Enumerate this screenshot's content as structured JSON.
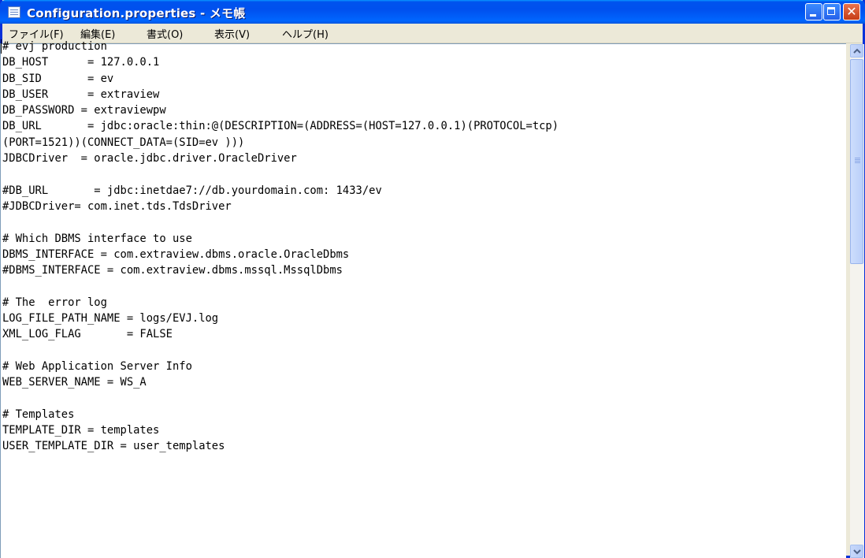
{
  "window": {
    "title": "Configuration.properties - メモ帳"
  },
  "menu": [
    {
      "label": "ファイル(F)"
    },
    {
      "label": "編集(E)"
    },
    {
      "label": "書式(O)"
    },
    {
      "label": "表示(V)"
    },
    {
      "label": "ヘルプ(H)"
    }
  ],
  "editor": {
    "lines": [
      "# evj production",
      "DB_HOST      = 127.0.0.1",
      "DB_SID       = ev",
      "DB_USER      = extraview",
      "DB_PASSWORD = extraviewpw",
      "DB_URL       = jdbc:oracle:thin:@(DESCRIPTION=(ADDRESS=(HOST=127.0.0.1)(PROTOCOL=tcp)",
      "(PORT=1521))(CONNECT_DATA=(SID=ev )))",
      "JDBCDriver  = oracle.jdbc.driver.OracleDriver",
      "",
      "#DB_URL       = jdbc:inetdae7://db.yourdomain.com: 1433/ev",
      "#JDBCDriver= com.inet.tds.TdsDriver",
      "",
      "# Which DBMS interface to use",
      "DBMS_INTERFACE = com.extraview.dbms.oracle.OracleDbms",
      "#DBMS_INTERFACE = com.extraview.dbms.mssql.MssqlDbms",
      "",
      "# The  error log",
      "LOG_FILE_PATH_NAME = logs/EVJ.log",
      "XML_LOG_FLAG       = FALSE",
      "",
      "# Web Application Server Info",
      "WEB_SERVER_NAME = WS_A",
      "",
      "# Templates",
      "TEMPLATE_DIR = templates",
      "USER_TEMPLATE_DIR = user_templates"
    ]
  },
  "icons": {
    "app": "notepad-icon",
    "minimize": "minimize-icon",
    "maximize": "maximize-icon",
    "close": "close-icon",
    "scroll_up": "scroll-up-arrow-icon",
    "scroll_down": "scroll-down-arrow-icon"
  },
  "colors": {
    "titlebar": "#0055e5",
    "close_button": "#d8502a",
    "spellcheck_underline": "#d40000"
  }
}
